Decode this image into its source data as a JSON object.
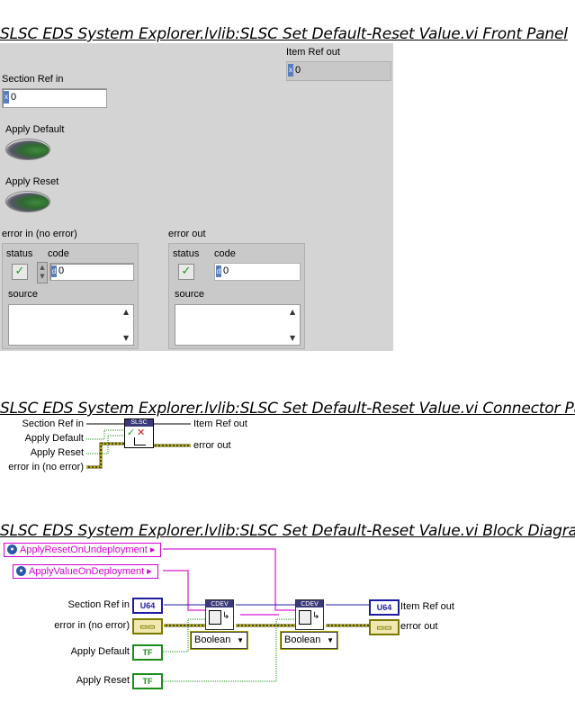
{
  "front_panel": {
    "title": "SLSC EDS System Explorer.lvlib:SLSC Set Default-Reset Value.vi Front Panel",
    "item_ref_out": {
      "label": "Item Ref out",
      "value": "0"
    },
    "section_ref_in": {
      "label": "Section Ref in",
      "value": "0"
    },
    "apply_default": {
      "label": "Apply Default"
    },
    "apply_reset": {
      "label": "Apply Reset"
    },
    "error_in": {
      "label": "error in (no error)",
      "status_label": "status",
      "code_label": "code",
      "code_value": "0",
      "source_label": "source"
    },
    "error_out": {
      "label": "error out",
      "status_label": "status",
      "code_label": "code",
      "code_value": "0",
      "source_label": "source"
    }
  },
  "connector_pane": {
    "title": "SLSC EDS System Explorer.lvlib:SLSC Set Default-Reset Value.vi Connector Pane",
    "icon_text": "SLSC",
    "inputs": [
      "Section Ref in",
      "Apply Default",
      "Apply Reset",
      "error in (no error)"
    ],
    "outputs": [
      "Item Ref out",
      "error out"
    ]
  },
  "block_diagram": {
    "title": "SLSC EDS System Explorer.lvlib:SLSC Set Default-Reset Value.vi Block Diagram",
    "prop_reset": "ApplyResetOnUndeployment",
    "prop_value": "ApplyValueOnDeployment",
    "section_ref_in": "Section Ref in",
    "error_in": "error in (no error)",
    "apply_default": "Apply Default",
    "apply_reset": "Apply Reset",
    "item_ref_out": "Item Ref out",
    "error_out": "error out",
    "u64_tag": "U64",
    "tf_tag": "TF",
    "vi_icon_text": "CDEV",
    "dropdown_1": "Boolean",
    "dropdown_2": "Boolean"
  }
}
